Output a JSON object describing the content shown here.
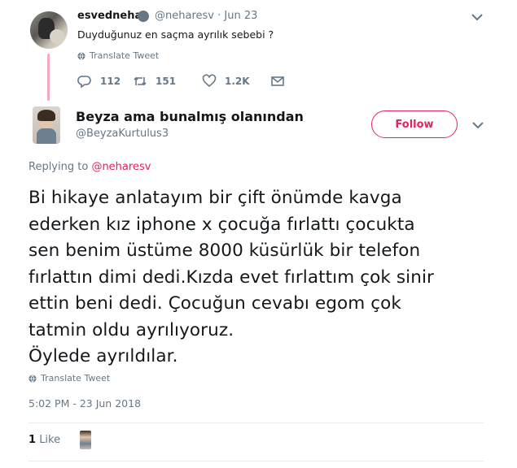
{
  "parent_tweet": {
    "display_name": "esvednehar",
    "handle": "@neharesv",
    "date": "· Jun 23",
    "text": "Duyduğunuz en saçma ayrılık sebebi ?",
    "translate_label": "Translate Tweet",
    "replies": "112",
    "retweets": "151",
    "likes": "1.2K"
  },
  "reply_tweet": {
    "display_name": "Beyza ama bunalmış olanından",
    "handle": "@BeyzaKurtulus3",
    "follow_label": "Follow",
    "replying_prefix": "Replying to",
    "replying_to": "@neharesv",
    "text": "Bi hikaye anlatayım bir çift önümde kavga\nederken kız iphone x çocuğa fırlattı çocukta\nsen benim üstüme 8000 küsürlük bir telefon\nfırlattın dimi dedi.Kızda evet fırlattım çok sinir\nettin beni dedi. Çocuğun cevabı egom çok\ntatmin oldu ayrılıyoruz.\nÖylede ayrıldılar.",
    "translate_label": "Translate Tweet",
    "timestamp": "5:02 PM - 23 Jun 2018",
    "like_count": "1",
    "like_label": "Like"
  },
  "colors": {
    "accent": "#e0245e",
    "muted": "#657786",
    "thread_line": "#f5aabf"
  },
  "icons": [
    "globe-icon",
    "reply-icon",
    "retweet-icon",
    "heart-icon",
    "message-icon",
    "chevron-down-icon"
  ]
}
